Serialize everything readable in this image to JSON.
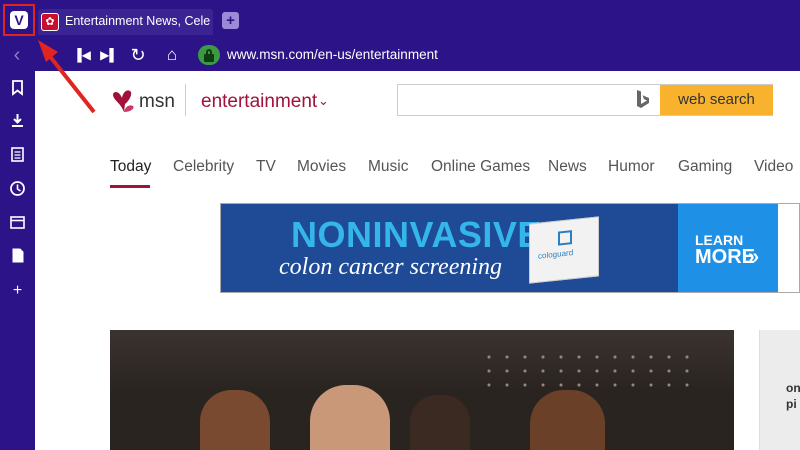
{
  "browser": {
    "tab_title": "Entertainment News, Celeb",
    "tab_favicon": "msn-butterfly-icon",
    "url": "www.msn.com/en-us/entertainment",
    "accent_color": "#2c1387"
  },
  "msn": {
    "brand": "msn",
    "section": "entertainment",
    "search_placeholder": "",
    "search_button": "web search"
  },
  "nav": {
    "items": [
      "Today",
      "Celebrity",
      "TV",
      "Movies",
      "Music",
      "Online Games",
      "News",
      "Humor",
      "Gaming",
      "Video"
    ]
  },
  "ad": {
    "headline": "NONINVASIVE",
    "subline": "colon cancer screening",
    "product": "cologuard",
    "cta_line1": "LEARN",
    "cta_line2": "MORE"
  },
  "side_card": {
    "text": "on pi"
  }
}
